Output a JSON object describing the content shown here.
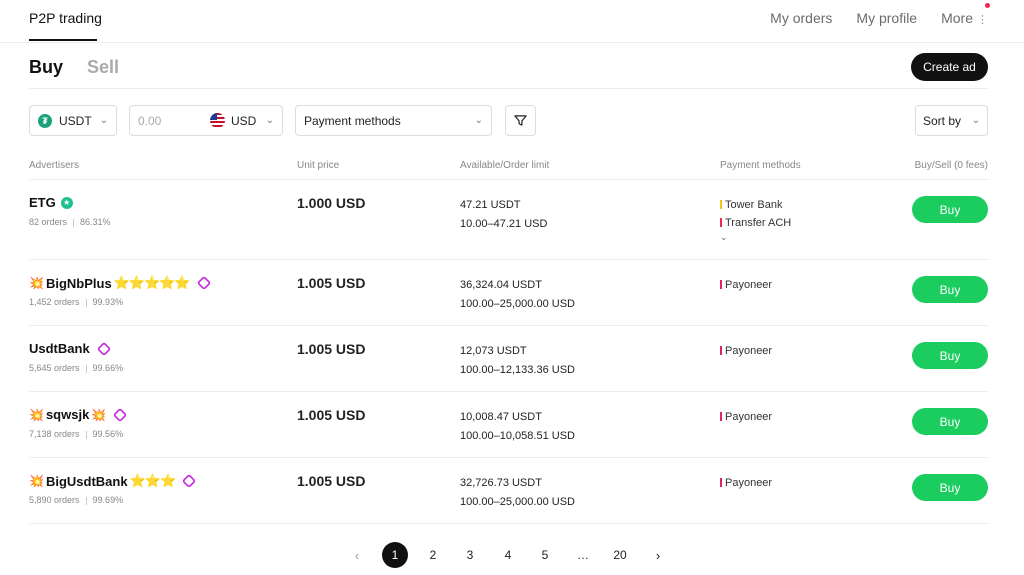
{
  "header": {
    "brand": "P2P trading",
    "nav": {
      "orders": "My orders",
      "profile": "My profile",
      "more": "More"
    }
  },
  "tabs": {
    "buy": "Buy",
    "sell": "Sell"
  },
  "create_ad": "Create ad",
  "filters": {
    "crypto": "USDT",
    "amount_placeholder": "0.00",
    "fiat": "USD",
    "payment": "Payment methods",
    "sort": "Sort by"
  },
  "columns": {
    "advertisers": "Advertisers",
    "price": "Unit price",
    "available": "Available/Order limit",
    "payment": "Payment methods",
    "action": "Buy/Sell (0 fees)"
  },
  "rows": [
    {
      "name": "ETG",
      "orders": "82 orders",
      "completion": "86.31%",
      "price": "1.000 USD",
      "available": "47.21 USDT",
      "limit": "10.00–47.21 USD",
      "payments": [
        "Tower Bank",
        "Transfer ACH"
      ],
      "button": "Buy"
    },
    {
      "name": "BigNbPlus",
      "orders": "1,452 orders",
      "completion": "99.93%",
      "price": "1.005 USD",
      "available": "36,324.04 USDT",
      "limit": "100.00–25,000.00 USD",
      "payments": [
        "Payoneer"
      ],
      "button": "Buy"
    },
    {
      "name": "UsdtBank",
      "orders": "5,645 orders",
      "completion": "99.66%",
      "price": "1.005 USD",
      "available": "12,073 USDT",
      "limit": "100.00–12,133.36 USD",
      "payments": [
        "Payoneer"
      ],
      "button": "Buy"
    },
    {
      "name": "sqwsjk",
      "orders": "7,138 orders",
      "completion": "99.56%",
      "price": "1.005 USD",
      "available": "10,008.47 USDT",
      "limit": "100.00–10,058.51 USD",
      "payments": [
        "Payoneer"
      ],
      "button": "Buy"
    },
    {
      "name": "BigUsdtBank",
      "orders": "5,890 orders",
      "completion": "99.69%",
      "price": "1.005 USD",
      "available": "32,726.73 USDT",
      "limit": "100.00–25,000.00 USD",
      "payments": [
        "Payoneer"
      ],
      "button": "Buy"
    }
  ],
  "pagination": {
    "pages": [
      "1",
      "2",
      "3",
      "4",
      "5",
      "…",
      "20"
    ],
    "current": "1"
  },
  "colors": {
    "buy_green": "#1bcc5f",
    "tether": "#1ba27a",
    "tower_bank": "#f6c31b",
    "transfer_ach": "#f0294a",
    "payoneer": "#e0245e",
    "merchant_badge": "#c629e0"
  }
}
